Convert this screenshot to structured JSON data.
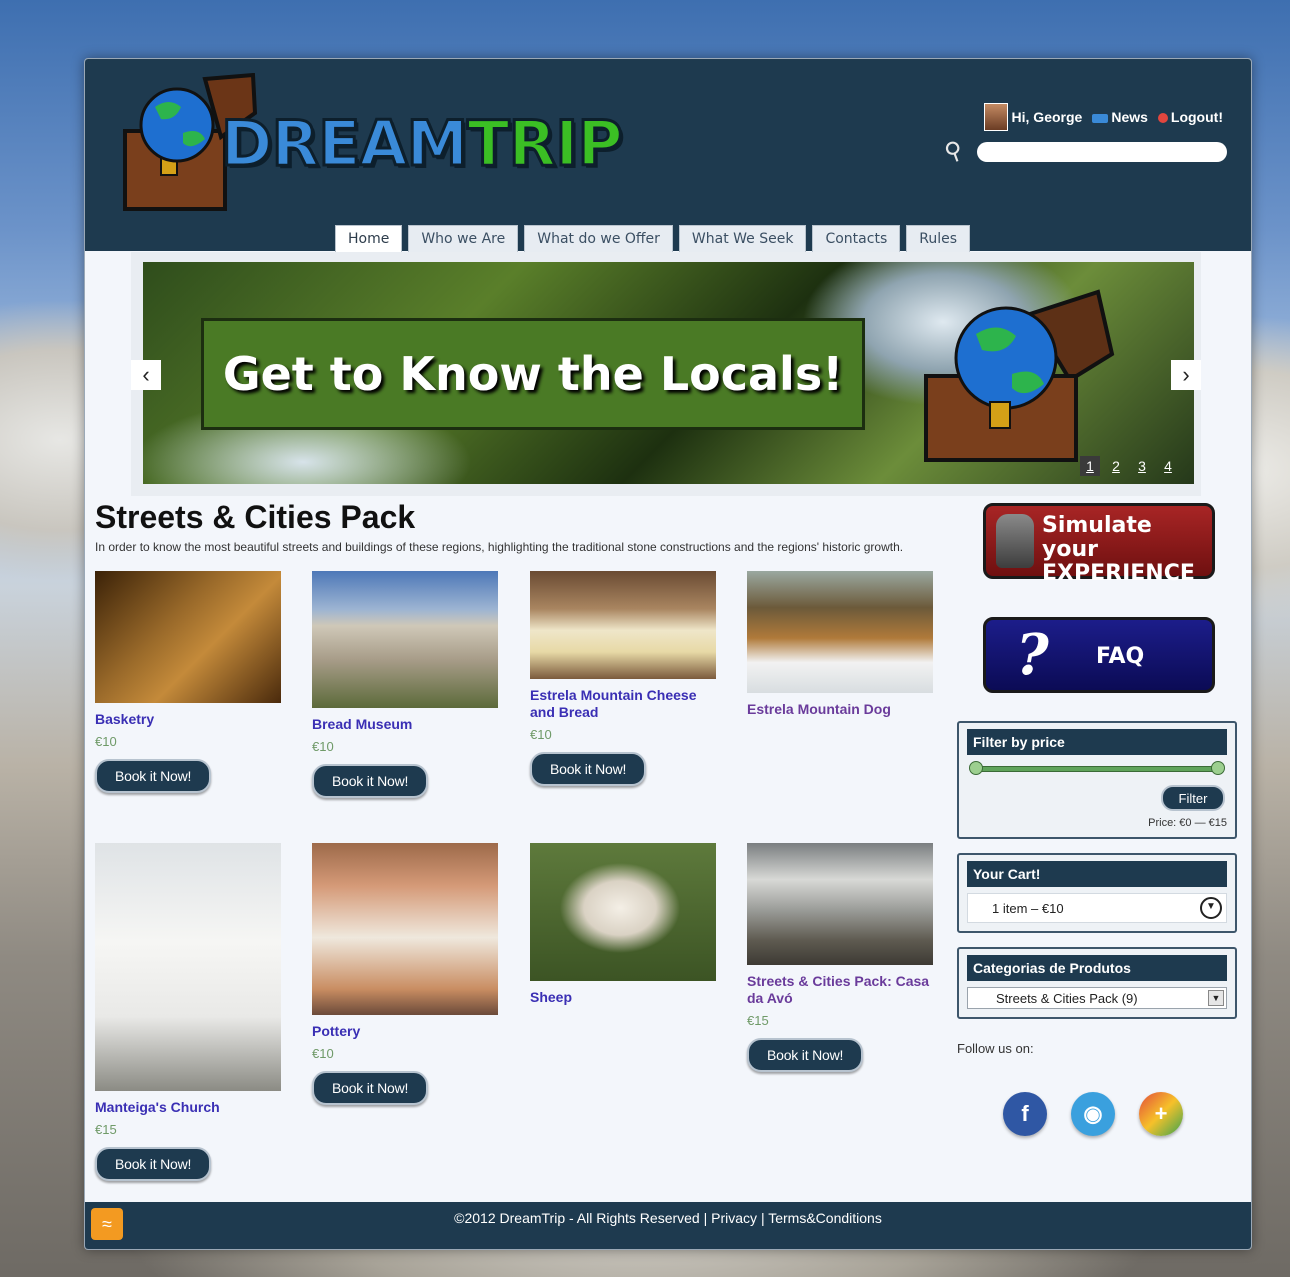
{
  "user": {
    "greeting": "Hi, George",
    "news": "News",
    "logout": "Logout!"
  },
  "search": {
    "placeholder": ""
  },
  "nav": [
    "Home",
    "Who we Are",
    "What do we Offer",
    "What We Seek",
    "Contacts",
    "Rules"
  ],
  "slider": {
    "banner": "Get to Know the Locals!",
    "pages": [
      "1",
      "2",
      "3",
      "4"
    ],
    "current": "1"
  },
  "category": {
    "title": "Streets & Cities Pack",
    "description": "In order to know the most beautiful streets and buildings of these regions, highlighting the traditional stone constructions and the regions' historic growth."
  },
  "products": [
    {
      "name": "Basketry",
      "price": "€10",
      "button": "Book it Now!"
    },
    {
      "name": "Bread Museum",
      "price": "€10",
      "button": "Book it Now!"
    },
    {
      "name": "Estrela Mountain Cheese and Bread",
      "price": "€10",
      "button": "Book it Now!"
    },
    {
      "name": "Estrela Mountain Dog",
      "price": "",
      "button": ""
    },
    {
      "name": "Manteiga's Church",
      "price": "€15",
      "button": "Book it Now!"
    },
    {
      "name": "Pottery",
      "price": "€10",
      "button": "Book it Now!"
    },
    {
      "name": "Sheep",
      "price": "",
      "button": ""
    },
    {
      "name": "Streets & Cities Pack: Casa da Avó",
      "price": "€15",
      "button": "Book it Now!"
    }
  ],
  "sidebar": {
    "simulate": {
      "line1": "Simulate your",
      "line2": "EXPERIENCE"
    },
    "faq": "FAQ",
    "filter": {
      "title": "Filter by price",
      "button": "Filter",
      "label": "Price: €0 — €15"
    },
    "cart": {
      "title": "Your Cart!",
      "summary": "1 item – €10"
    },
    "categories": {
      "title": "Categorias de Produtos",
      "selected": "Streets & Cities Pack  (9)"
    },
    "follow": "Follow us on:"
  },
  "footer": {
    "copyright": "©2012 DreamTrip - All Rights Reserved |",
    "privacy": "Privacy",
    "sep": "|",
    "terms": "Terms&Conditions"
  }
}
